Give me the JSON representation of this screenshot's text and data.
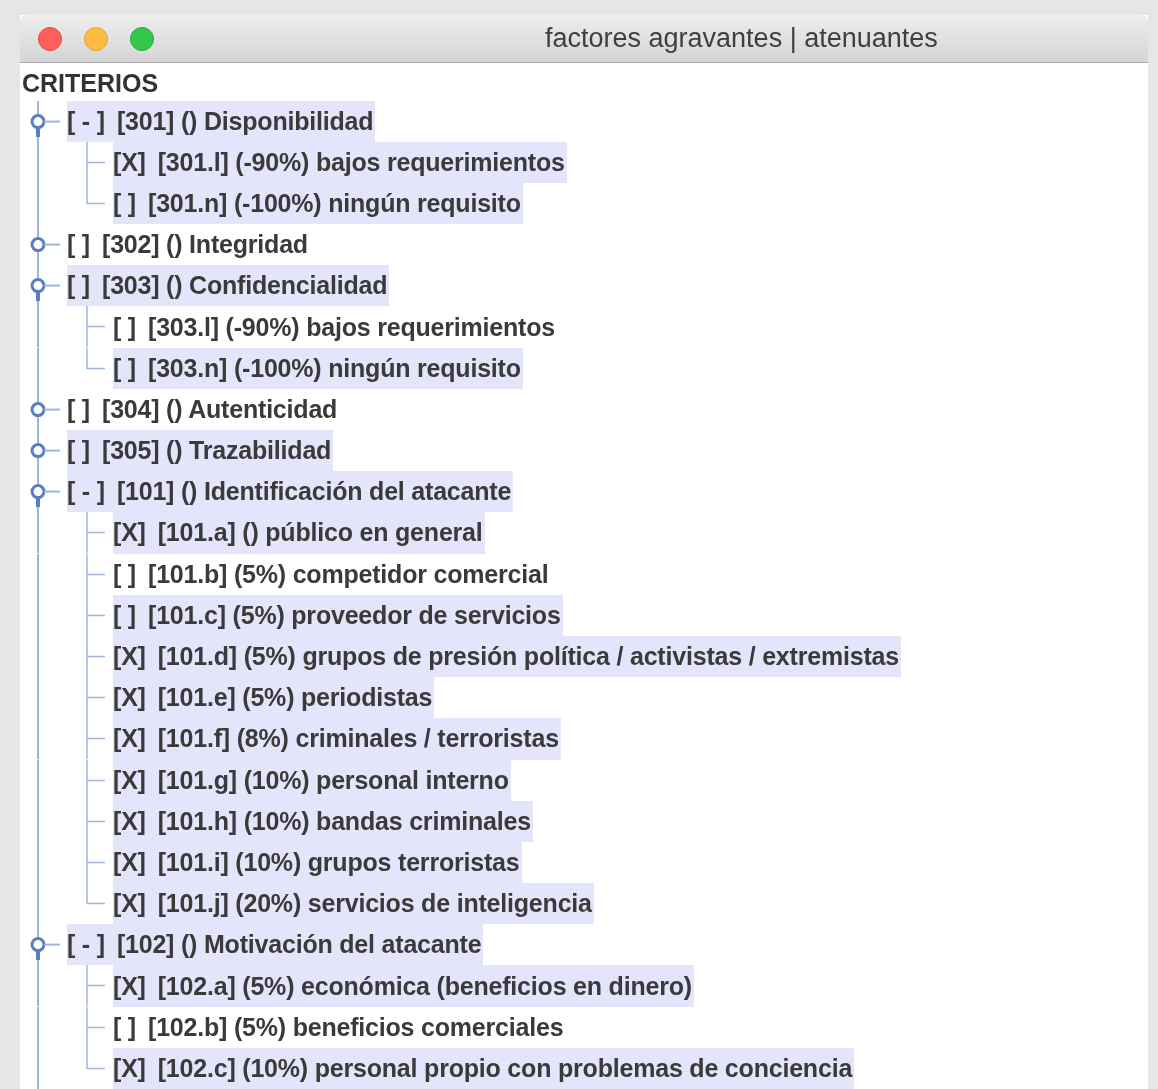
{
  "window": {
    "title": "factores agravantes | atenuantes"
  },
  "tree": {
    "heading": "CRITERIOS",
    "items": [
      {
        "mark": "[ - ]",
        "label": "[301] () Disponibilidad",
        "expanded": true,
        "highlighted": true,
        "children": [
          {
            "mark": "[X]",
            "label": "[301.l] (-90%) bajos requerimientos",
            "highlighted": true
          },
          {
            "mark": "[ ]",
            "label": "[301.n] (-100%) ningún requisito",
            "highlighted": true
          }
        ]
      },
      {
        "mark": "[ ]",
        "label": "[302] () Integridad",
        "expanded": false,
        "highlighted": false
      },
      {
        "mark": "[ ]",
        "label": "[303] () Confidencialidad",
        "expanded": true,
        "highlighted": true,
        "children": [
          {
            "mark": "[ ]",
            "label": "[303.l] (-90%) bajos requerimientos",
            "highlighted": false
          },
          {
            "mark": "[ ]",
            "label": "[303.n] (-100%) ningún requisito",
            "highlighted": true
          }
        ]
      },
      {
        "mark": "[ ]",
        "label": "[304] () Autenticidad",
        "expanded": false,
        "highlighted": false
      },
      {
        "mark": "[ ]",
        "label": "[305] () Trazabilidad",
        "expanded": false,
        "highlighted": true
      },
      {
        "mark": "[ - ]",
        "label": "[101] () Identificación del atacante",
        "expanded": true,
        "highlighted": true,
        "children": [
          {
            "mark": "[X]",
            "label": "[101.a] () público en general",
            "highlighted": true
          },
          {
            "mark": "[ ]",
            "label": "[101.b] (5%) competidor comercial",
            "highlighted": false
          },
          {
            "mark": "[ ]",
            "label": "[101.c] (5%) proveedor de servicios",
            "highlighted": true
          },
          {
            "mark": "[X]",
            "label": "[101.d] (5%) grupos de presión política / activistas / extremistas",
            "highlighted": true
          },
          {
            "mark": "[X]",
            "label": "[101.e] (5%) periodistas",
            "highlighted": true
          },
          {
            "mark": "[X]",
            "label": "[101.f] (8%) criminales / terroristas",
            "highlighted": true
          },
          {
            "mark": "[X]",
            "label": "[101.g] (10%) personal interno",
            "highlighted": true
          },
          {
            "mark": "[X]",
            "label": "[101.h] (10%) bandas criminales",
            "highlighted": true
          },
          {
            "mark": "[X]",
            "label": "[101.i] (10%) grupos terroristas",
            "highlighted": true
          },
          {
            "mark": "[X]",
            "label": "[101.j] (20%) servicios de inteligencia",
            "highlighted": true
          }
        ]
      },
      {
        "mark": "[ - ]",
        "label": "[102] () Motivación del atacante",
        "expanded": true,
        "highlighted": true,
        "children": [
          {
            "mark": "[X]",
            "label": "[102.a] (5%) económica (beneficios en dinero)",
            "highlighted": true
          },
          {
            "mark": "[ ]",
            "label": "[102.b] (5%) beneficios comerciales",
            "highlighted": false
          },
          {
            "mark": "[X]",
            "label": "[102.c] (10%) personal propio con problemas de conciencia",
            "highlighted": true
          }
        ]
      }
    ]
  }
}
